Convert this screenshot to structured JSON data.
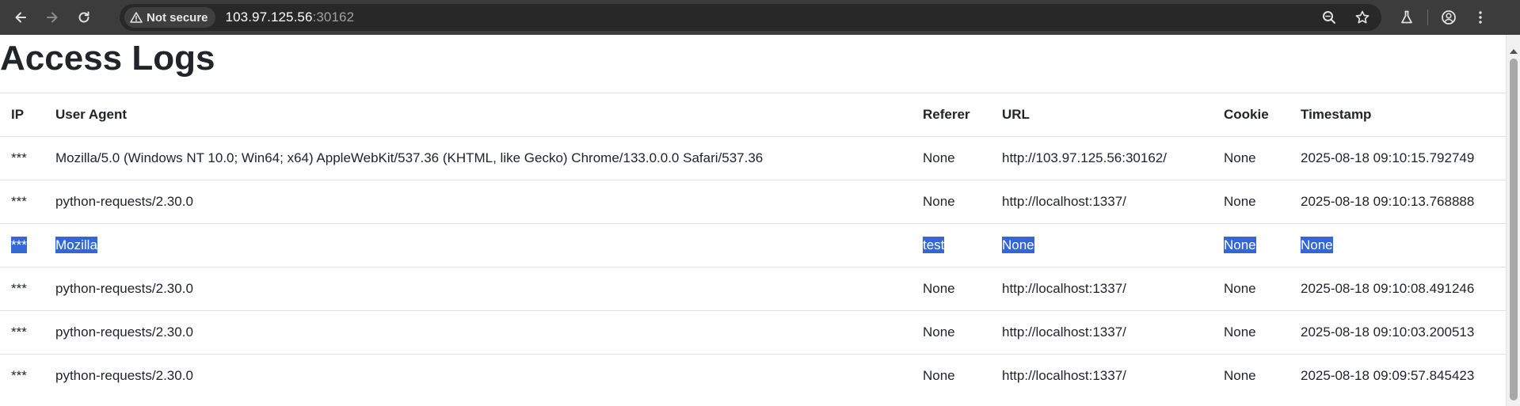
{
  "browser": {
    "security_label": "Not secure",
    "url_host": "103.97.125.56",
    "url_port": ":30162"
  },
  "page": {
    "title": "Access Logs"
  },
  "table": {
    "headers": [
      "IP",
      "User Agent",
      "Referer",
      "URL",
      "Cookie",
      "Timestamp"
    ],
    "rows": [
      [
        "***",
        "Mozilla/5.0 (Windows NT 10.0; Win64; x64) AppleWebKit/537.36 (KHTML, like Gecko) Chrome/133.0.0.0 Safari/537.36",
        "None",
        "http://103.97.125.56:30162/",
        "None",
        "2025-08-18 09:10:15.792749"
      ],
      [
        "***",
        "python-requests/2.30.0",
        "None",
        "http://localhost:1337/",
        "None",
        "2025-08-18 09:10:13.768888"
      ],
      [
        "***",
        "Mozilla",
        "test",
        "None",
        "None",
        "None"
      ],
      [
        "***",
        "python-requests/2.30.0",
        "None",
        "http://localhost:1337/",
        "None",
        "2025-08-18 09:10:08.491246"
      ],
      [
        "***",
        "python-requests/2.30.0",
        "None",
        "http://localhost:1337/",
        "None",
        "2025-08-18 09:10:03.200513"
      ],
      [
        "***",
        "python-requests/2.30.0",
        "None",
        "http://localhost:1337/",
        "None",
        "2025-08-18 09:09:57.845423"
      ]
    ],
    "selected_row_index": 2
  },
  "icons": {
    "back": "back-arrow-icon",
    "forward": "forward-arrow-icon",
    "reload": "reload-icon",
    "warning": "warning-triangle-icon",
    "zoom": "zoom-icon",
    "bookmark": "star-icon",
    "labs": "flask-icon",
    "profile": "account-icon",
    "menu": "kebab-menu-icon"
  },
  "colors": {
    "toolbar": "#3c3c3c",
    "selection": "#3367d6",
    "text": "#212529"
  }
}
